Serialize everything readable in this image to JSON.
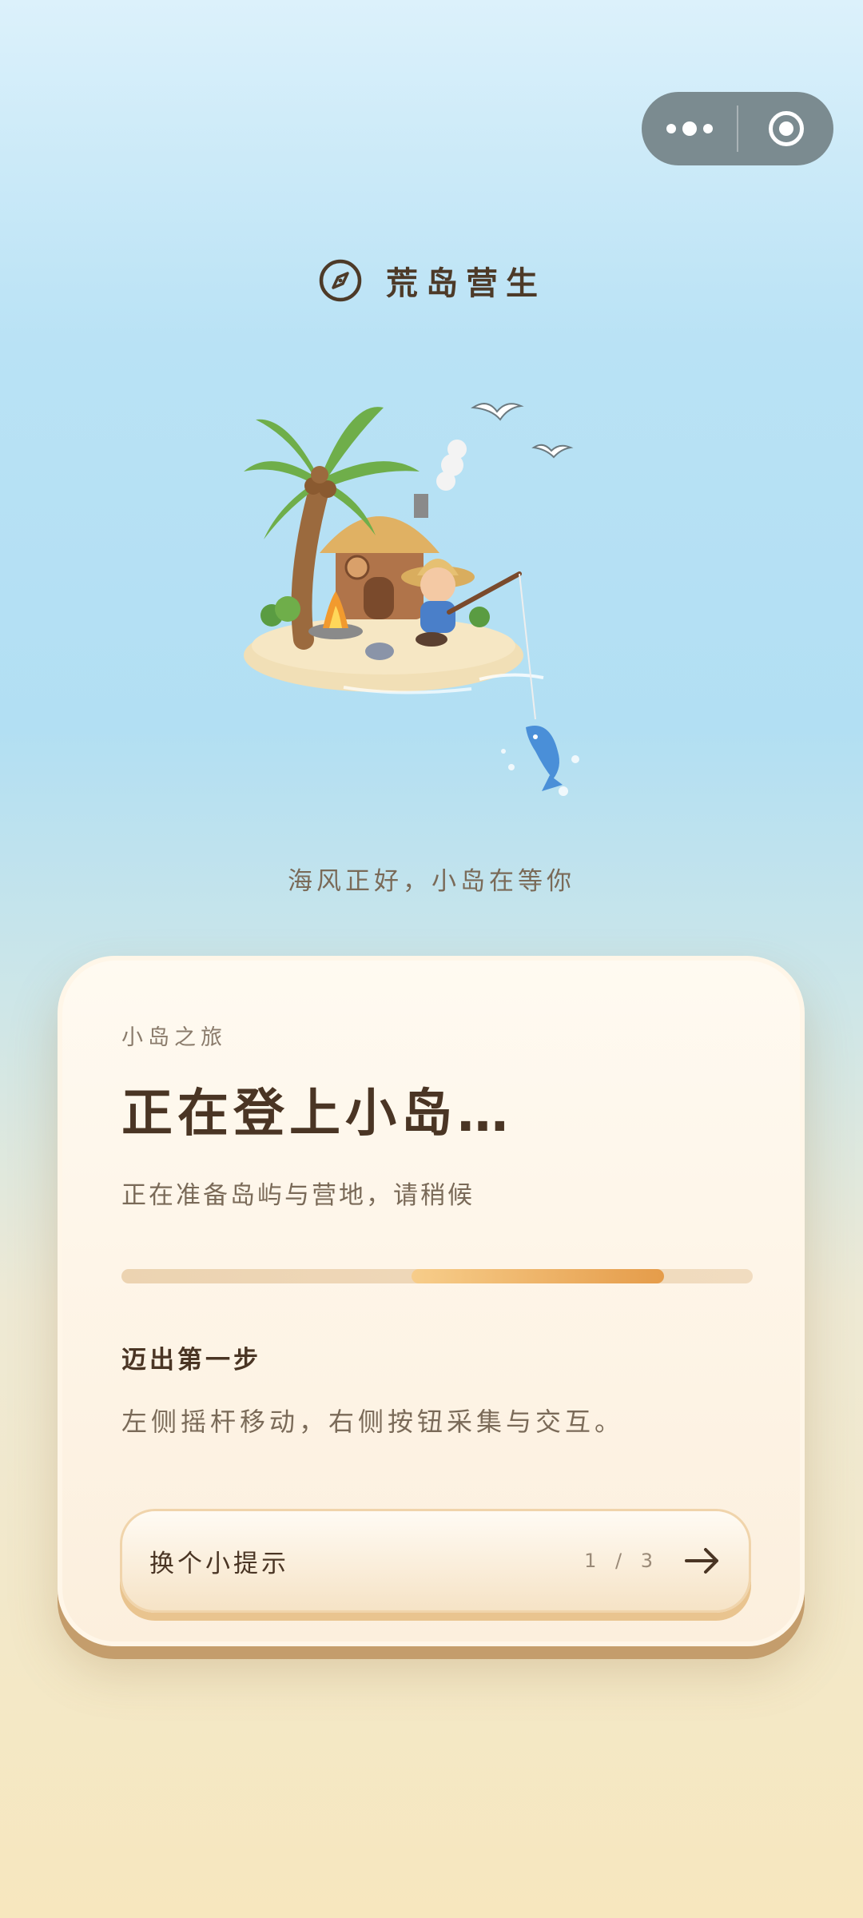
{
  "colors": {
    "title": "#4a3524",
    "muted": "#7a6a58",
    "progress_fill": "#e59c4a",
    "capsule": "#7b8b90"
  },
  "capsule": {
    "more_icon": "more-dots-icon",
    "close_icon": "target-circle-icon"
  },
  "header": {
    "icon": "compass-icon",
    "title": "荒岛营生"
  },
  "tagline": "海风正好，小岛在等你",
  "card": {
    "kicker": "小岛之旅",
    "title": "正在登上小岛…",
    "subtitle": "正在准备岛屿与营地，请稍候",
    "progress": {
      "start": 0.46,
      "end": 0.86
    },
    "tip_title": "迈出第一步",
    "tip_text": "左侧摇杆移动，右侧按钮采集与交互。",
    "tip_button": {
      "label": "换个小提示",
      "count": "1 / 3",
      "icon": "arrow-right-icon"
    }
  }
}
